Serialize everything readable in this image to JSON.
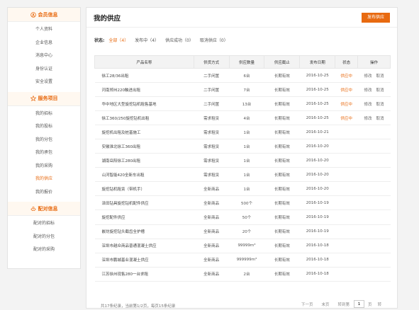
{
  "sidebar": {
    "sections": [
      {
        "title": "会员信息",
        "icon": "user-circle-icon",
        "items": [
          "个人资料",
          "企业信息",
          "消息中心",
          "身份认证",
          "安全设置"
        ]
      },
      {
        "title": "服务项目",
        "icon": "star-icon",
        "items": [
          "我的招标",
          "我的投标",
          "我的分包",
          "我的承包",
          "我的采购",
          "我的供应",
          "我的报价"
        ]
      },
      {
        "title": "配对信息",
        "icon": "handshake-icon",
        "items": [
          "配对的招标",
          "配对的分包",
          "配对的采购"
        ]
      }
    ],
    "active_item": "我的供应"
  },
  "main": {
    "title": "我的供应",
    "publish_label": "发布供应",
    "filter_label": "状态:",
    "filters": [
      "全部（4）",
      "发布中（4）",
      "供应成功（0）",
      "取消供应（0）"
    ],
    "columns": [
      "产品名称",
      "供货方式",
      "供应数量",
      "供应截止",
      "发布日期",
      "状态",
      "操作"
    ],
    "rows": [
      [
        "徐工28/36出租",
        "二手闲置",
        "6台",
        "长期有效",
        "2016-10-25",
        "供应中",
        "修改",
        "取消"
      ],
      [
        "河南郑州220触进出租",
        "二手闲置",
        "7台",
        "长期有效",
        "2016-10-25",
        "供应中",
        "修改",
        "取消"
      ],
      [
        "华中地区大型旋挖钻机租售基地",
        "二手闲置",
        "13台",
        "长期有效",
        "2016-10-25",
        "供应中",
        "修改",
        "取消"
      ],
      [
        "徐工360/250旋挖钻机出租",
        "需求租赁",
        "4台",
        "长期有效",
        "2016-10-25",
        "供应中",
        "修改",
        "取消"
      ],
      [
        "旋挖机出租及桩基施工",
        "需求租赁",
        "1台",
        "长期有效",
        "2016-10-21",
        "",
        "",
        ""
      ],
      [
        "安徽淮北徐工360出租",
        "需求租赁",
        "1台",
        "长期有效",
        "2016-10-20",
        "",
        "",
        ""
      ],
      [
        "湖南岳阳徐工280出租",
        "需求租赁",
        "1台",
        "长期有效",
        "2016-10-20",
        "",
        "",
        ""
      ],
      [
        "山河智能420全新车出租",
        "需求租赁",
        "1台",
        "长期有效",
        "2016-10-20",
        "",
        "",
        ""
      ],
      [
        "旋挖钻机租赁（带机手）",
        "全新商品",
        "1台",
        "长期有效",
        "2016-10-20",
        "",
        "",
        ""
      ],
      [
        "泽田钻具旋挖钻机配件供应",
        "全新商品",
        "500个",
        "长期有效",
        "2016-10-19",
        "",
        "",
        ""
      ],
      [
        "旋挖配件供应",
        "全新商品",
        "50个",
        "长期有效",
        "2016-10-19",
        "",
        "",
        ""
      ],
      [
        "嵌坊旋挖钻头截齿全护槽",
        "全新商品",
        "20个",
        "长期有效",
        "2016-10-19",
        "",
        "",
        ""
      ],
      [
        "深圳市越众商品普通混凝土供应",
        "全新商品",
        "99999m³",
        "长期有效",
        "2016-10-18",
        "",
        "",
        ""
      ],
      [
        "深圳市鹏城基业混凝土供应",
        "全新商品",
        "999999m³",
        "长期有效",
        "2016-10-18",
        "",
        "",
        ""
      ],
      [
        "江苏徐州现售280一台求租",
        "全新商品",
        "2台",
        "长期有效",
        "2016-10-18",
        "",
        "",
        ""
      ]
    ]
  },
  "pagination": {
    "info": "共17条纪录，当前第1/2页，每页15条纪录",
    "next": "下一页",
    "last": "末页",
    "goto_label": "转到第",
    "page_value": "1",
    "page_unit": "页",
    "go_label": "转"
  },
  "colors": {
    "accent": "#e86a10"
  }
}
